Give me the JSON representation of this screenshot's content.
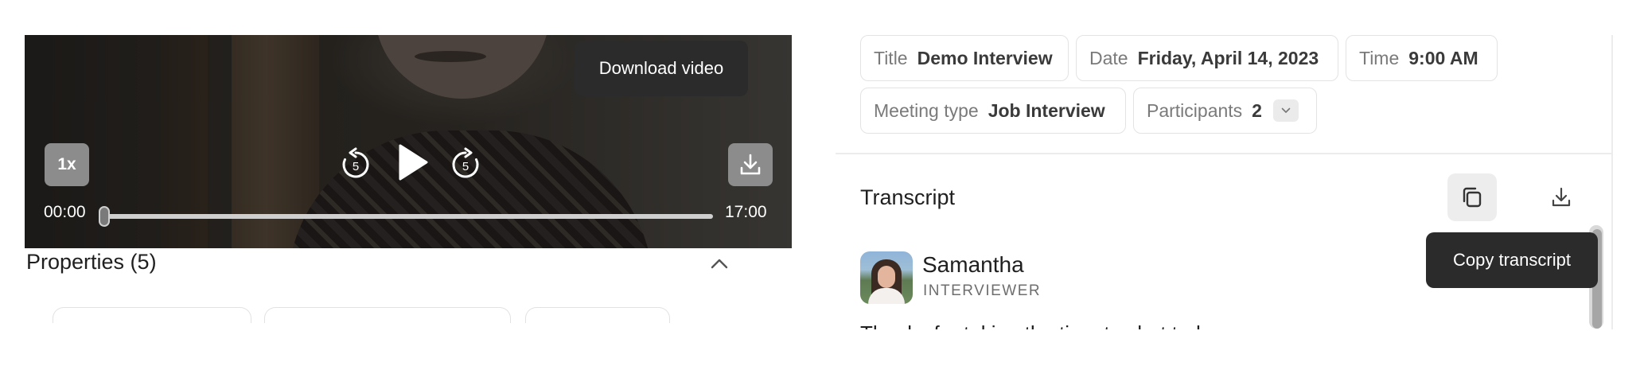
{
  "video": {
    "speed_label": "1x",
    "rewind_seconds": "5",
    "forward_seconds": "5",
    "current_time": "00:00",
    "duration": "17:00",
    "progress_fraction": 0.0,
    "download_tooltip": "Download video"
  },
  "properties": {
    "header": "Properties (5)"
  },
  "meeting": {
    "title_key": "Title",
    "title_value": "Demo Interview",
    "date_key": "Date",
    "date_value": "Friday, April 14, 2023",
    "time_key": "Time",
    "time_value": "9:00 AM",
    "meeting_type_key": "Meeting type",
    "meeting_type_value": "Job Interview",
    "participants_key": "Participants",
    "participants_value": "2"
  },
  "transcript": {
    "title": "Transcript",
    "copy_tooltip": "Copy transcript",
    "speaker_name": "Samantha",
    "speaker_role": "INTERVIEWER",
    "snippet": "Thanks for taking the time to chat today."
  },
  "icons": {
    "rewind": "rewind-5-icon",
    "play": "play-icon",
    "forward": "forward-5-icon",
    "download": "download-icon",
    "copy": "copy-icon",
    "chevron_up": "chevron-up-icon",
    "chevron_down": "chevron-down-icon"
  }
}
